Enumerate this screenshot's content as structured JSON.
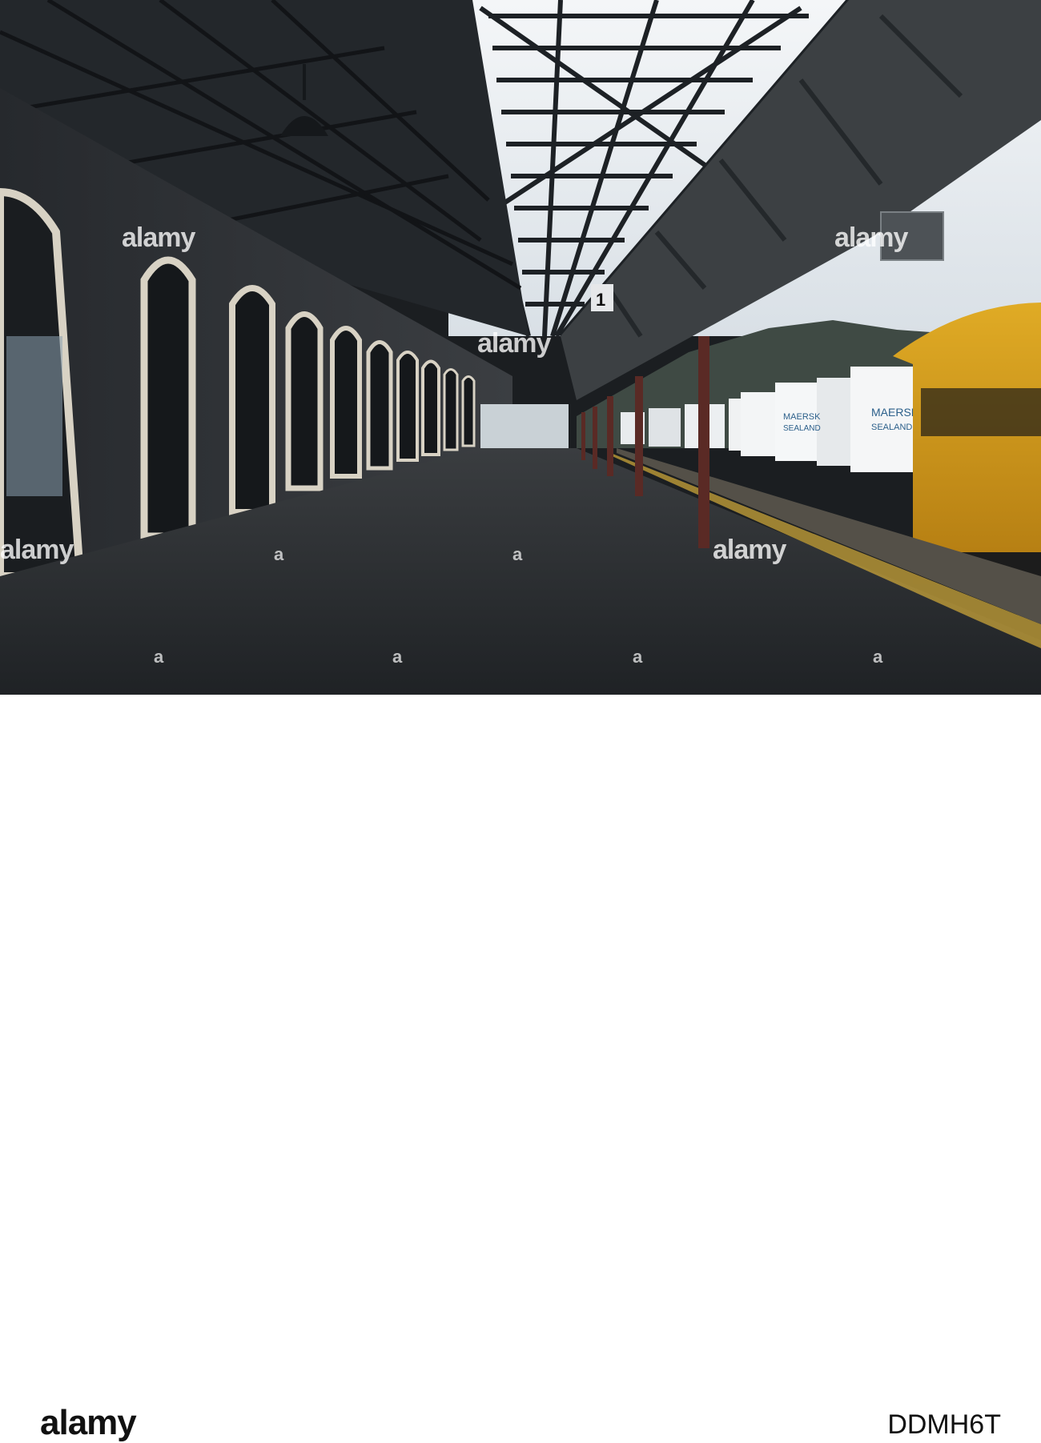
{
  "scene": {
    "platform_number": "1",
    "container_logo_1": "MAERSK",
    "container_logo_1_sub": "SEALAND",
    "container_logo_2": "MAERSK",
    "container_logo_2_sub": "SEALAND"
  },
  "watermark": {
    "text": "alamy",
    "footer_logo": "alamy",
    "image_id": "DDMH6T"
  },
  "colors": {
    "roof_steel": "#2a2e32",
    "sky": "#e8eef4",
    "stone_wall": "#2f3338",
    "arch_trim": "#d8d2c4",
    "platform": "#2c2f33",
    "carriage_yellow": "#d9a21c",
    "container_white": "#f0f2f3"
  }
}
